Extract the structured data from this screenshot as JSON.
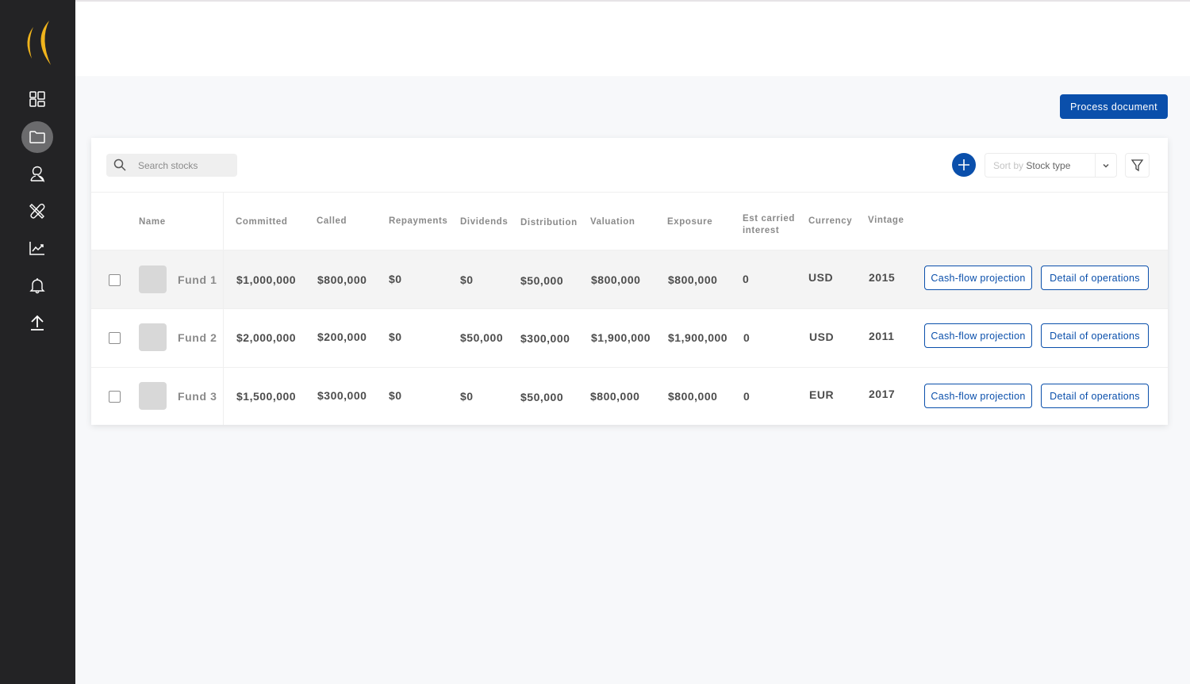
{
  "colors": {
    "sidebar_bg": "#232325",
    "accent": "#0a4fab",
    "logo": "#f0b41c"
  },
  "sidebar": {
    "items": [
      {
        "name": "dashboard",
        "icon": "dashboard-icon",
        "active": false
      },
      {
        "name": "documents",
        "icon": "folder-icon",
        "active": true
      },
      {
        "name": "contacts",
        "icon": "user-icon",
        "active": false
      },
      {
        "name": "tools",
        "icon": "tools-icon",
        "active": false
      },
      {
        "name": "analytics",
        "icon": "chart-icon",
        "active": false
      },
      {
        "name": "notifications",
        "icon": "bell-icon",
        "active": false
      },
      {
        "name": "upload",
        "icon": "upload-icon",
        "active": false
      }
    ]
  },
  "toolbar": {
    "process_label": "Process document",
    "search_placeholder": "Search stocks",
    "sort_prefix": "Sort by",
    "sort_value": "Stock type"
  },
  "table": {
    "columns": [
      "Name",
      "Committed",
      "Called",
      "Repayments",
      "Dividends",
      "Distribution",
      "Valuation",
      "Exposure",
      "Est carried interest",
      "Currency",
      "Vintage"
    ],
    "rows": [
      {
        "name": "Fund 1",
        "committed": "$1,000,000",
        "called": "$800,000",
        "repayments": "$0",
        "dividends": "$0",
        "distribution": "$50,000",
        "valuation": "$800,000",
        "exposure": "$800,000",
        "carried": "0",
        "currency": "USD",
        "vintage": "2015",
        "cash_label": "Cash-flow projection",
        "detail_label": "Detail of operations"
      },
      {
        "name": "Fund 2",
        "committed": "$2,000,000",
        "called": "$200,000",
        "repayments": "$0",
        "dividends": "$50,000",
        "distribution": "$300,000",
        "valuation": "$1,900,000",
        "exposure": "$1,900,000",
        "carried": "0",
        "currency": "USD",
        "vintage": "2011",
        "cash_label": "Cash-flow projection",
        "detail_label": "Detail of operations"
      },
      {
        "name": "Fund 3",
        "committed": "$1,500,000",
        "called": "$300,000",
        "repayments": "$0",
        "dividends": "$0",
        "distribution": "$50,000",
        "valuation": "$800,000",
        "exposure": "$800,000",
        "carried": "0",
        "currency": "EUR",
        "vintage": "2017",
        "cash_label": "Cash-flow projection",
        "detail_label": "Detail of operations"
      }
    ]
  }
}
